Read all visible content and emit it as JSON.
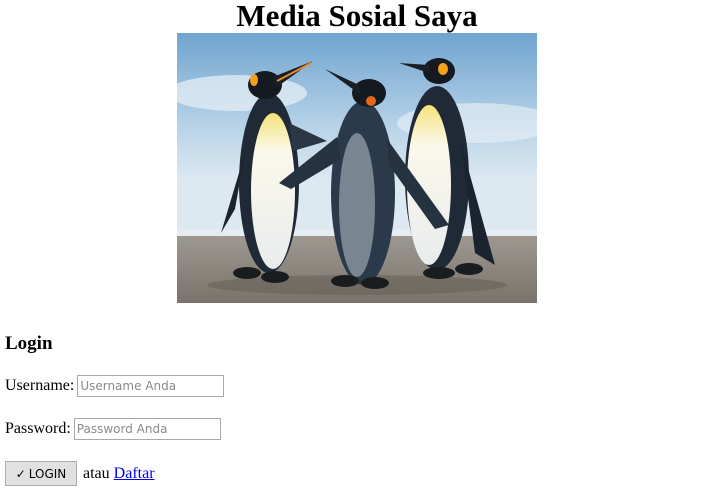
{
  "header": {
    "title": "Media Sosial Saya"
  },
  "hero": {
    "subject": "three emperor penguins on a beach"
  },
  "login": {
    "heading": "Login",
    "username_label": "Username:",
    "username_placeholder": "Username Anda",
    "username_value": "",
    "password_label": "Password:",
    "password_placeholder": "Password Anda",
    "password_value": "",
    "button_icon": "✓",
    "button_label": "LOGIN",
    "or_text": "atau",
    "register_link": "Daftar"
  },
  "colors": {
    "link": "#0000ee",
    "button_bg": "#e1e1e1",
    "input_border": "#a9a9a9"
  }
}
